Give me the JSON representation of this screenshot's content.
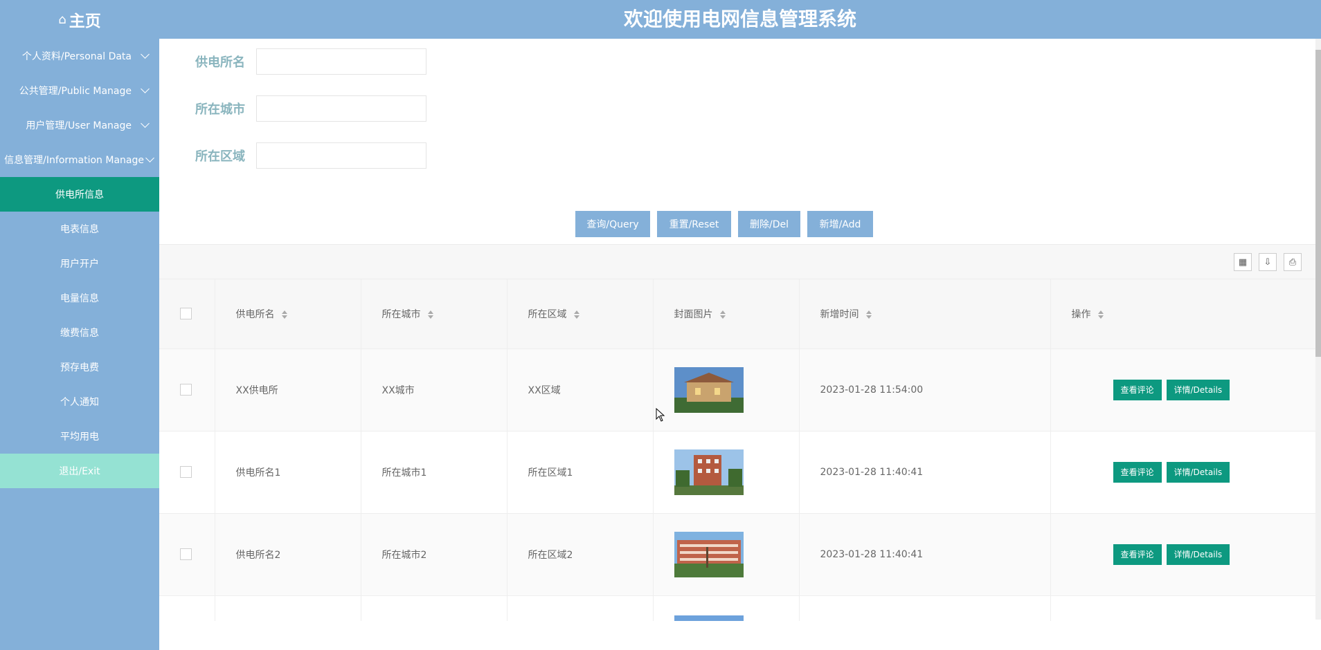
{
  "header": {
    "home_label": "主页",
    "site_title": "欢迎使用电网信息管理系统"
  },
  "sidebar": {
    "items": [
      {
        "label": "个人资料/Personal Data",
        "type": "group"
      },
      {
        "label": "公共管理/Public Manage",
        "type": "group"
      },
      {
        "label": "用户管理/User Manage",
        "type": "group"
      },
      {
        "label": "信息管理/Information Manage",
        "type": "group"
      },
      {
        "label": "供电所信息",
        "type": "active"
      },
      {
        "label": "电表信息",
        "type": "item"
      },
      {
        "label": "用户开户",
        "type": "item"
      },
      {
        "label": "电量信息",
        "type": "item"
      },
      {
        "label": "缴费信息",
        "type": "item"
      },
      {
        "label": "预存电费",
        "type": "item"
      },
      {
        "label": "个人通知",
        "type": "item"
      },
      {
        "label": "平均用电",
        "type": "item"
      },
      {
        "label": "退出/Exit",
        "type": "exit"
      }
    ]
  },
  "search": {
    "station_label": "供电所名",
    "station_value": "",
    "city_label": "所在城市",
    "city_value": "",
    "district_label": "所在区域",
    "district_value": ""
  },
  "actions": {
    "query": "查询/Query",
    "reset": "重置/Reset",
    "delete": "删除/Del",
    "add": "新增/Add"
  },
  "table": {
    "headers": {
      "name": "供电所名",
      "city": "所在城市",
      "district": "所在区域",
      "cover": "封面图片",
      "time": "新增时间",
      "ops": "操作"
    },
    "op_labels": {
      "comments": "查看评论",
      "details": "详情/Details"
    },
    "rows": [
      {
        "name": "XX供电所",
        "city": "XX城市",
        "district": "XX区域",
        "time": "2023-01-28 11:54:00"
      },
      {
        "name": "供电所名1",
        "city": "所在城市1",
        "district": "所在区域1",
        "time": "2023-01-28 11:40:41"
      },
      {
        "name": "供电所名2",
        "city": "所在城市2",
        "district": "所在区域2",
        "time": "2023-01-28 11:40:41"
      }
    ]
  },
  "colors": {
    "primary": "#84b0d9",
    "accent": "#0d9980",
    "exit": "#95e2d3",
    "label": "#8ab5be"
  }
}
